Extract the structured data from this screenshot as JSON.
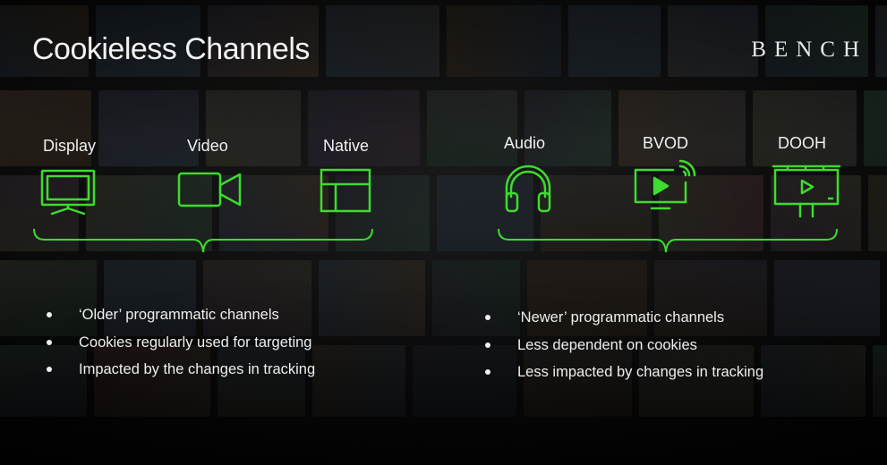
{
  "slide": {
    "title": "Cookieless Channels",
    "logo": "BENCH",
    "accent_color": "#3ddc2e"
  },
  "older_group": {
    "channels": [
      {
        "label": "Display",
        "icon": "monitor-icon"
      },
      {
        "label": "Video",
        "icon": "video-camera-icon"
      },
      {
        "label": "Native",
        "icon": "layout-icon"
      }
    ],
    "bullets": [
      "‘Older’ programmatic channels",
      "Cookies regularly used for targeting",
      "Impacted by the changes in tracking"
    ]
  },
  "newer_group": {
    "channels": [
      {
        "label": "Audio",
        "icon": "headphones-icon"
      },
      {
        "label": "BVOD",
        "icon": "connected-tv-icon"
      },
      {
        "label": "DOOH",
        "icon": "billboard-icon"
      }
    ],
    "bullets": [
      "‘Newer’ programmatic channels",
      "Less dependent on cookies",
      "Less impacted by changes in tracking"
    ]
  }
}
